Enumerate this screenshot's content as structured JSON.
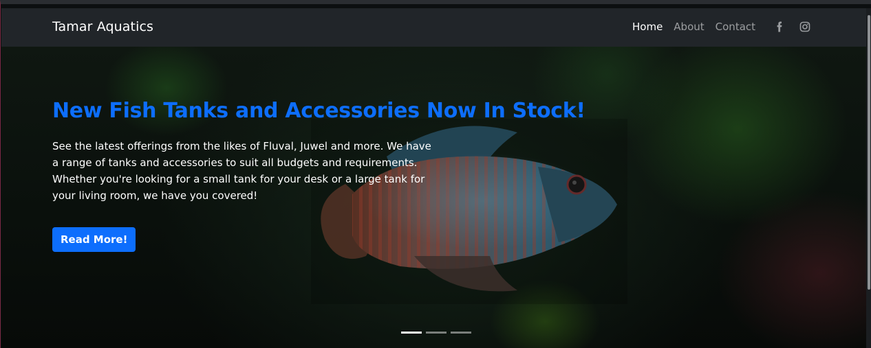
{
  "navbar": {
    "brand": "Tamar Aquatics",
    "links": [
      {
        "label": "Home",
        "active": true
      },
      {
        "label": "About",
        "active": false
      },
      {
        "label": "Contact",
        "active": false
      }
    ],
    "social": [
      {
        "icon": "facebook-icon"
      },
      {
        "icon": "instagram-icon"
      }
    ]
  },
  "hero": {
    "title": "New Fish Tanks and Accessories Now In Stock!",
    "text": "See the latest offerings from the likes of Fluval, Juwel and more. We have a range of tanks and accessories to suit all budgets and requirements. Whether you're looking for a small tank for your desk or a large tank for your living room, we have you covered!",
    "button_label": "Read More!",
    "slides": 3,
    "active_slide": 0
  },
  "colors": {
    "accent": "#0d6efd",
    "navbar_bg": "#212529"
  }
}
